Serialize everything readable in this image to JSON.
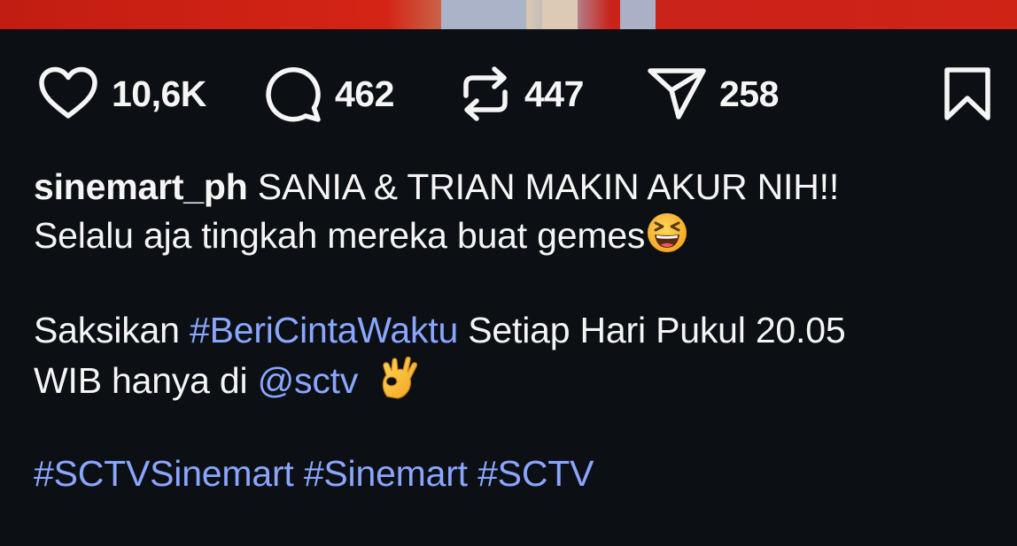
{
  "colors": {
    "background": "#0c1014",
    "text": "#f5f5f5",
    "link": "#8aa6ff"
  },
  "actions": {
    "like_count": "10,6K",
    "comment_count": "462",
    "repost_count": "447",
    "share_count": "258"
  },
  "caption": {
    "username": "sinemart_ph",
    "line1_text": " SANIA & TRIAN MAKIN AKUR NIH!!",
    "line2_text": "Selalu aja tingkah mereka buat gemes",
    "line2_emoji": "grinning-squinting-face-emoji",
    "line4_pre": "Saksikan ",
    "line4_hashtag": "#BeriCintaWaktu",
    "line4_post": " Setiap Hari Pukul 20.05",
    "line5_pre": "WIB hanya di ",
    "line5_mention": "@sctv",
    "line5_emoji": "ok-hand-emoji",
    "hashtags": [
      "#SCTVSinemart",
      "#Sinemart",
      "#SCTV"
    ]
  }
}
